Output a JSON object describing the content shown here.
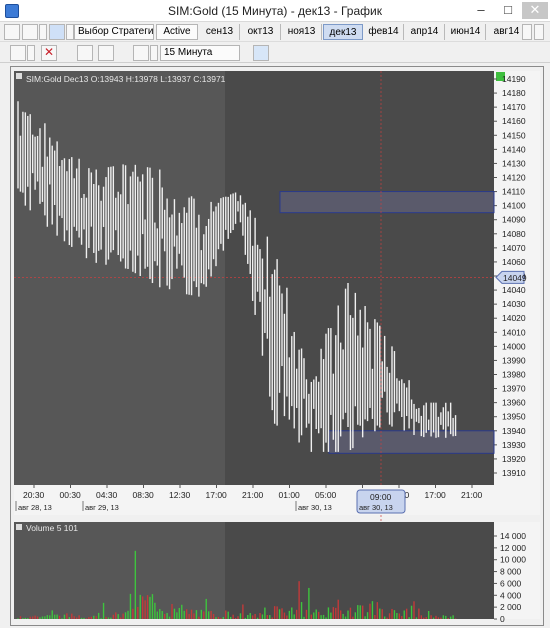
{
  "window": {
    "title": "SIM:Gold (15 Минута) - дек13 - График",
    "minimize": "–",
    "maximize": "□",
    "close": "✕"
  },
  "toolbar": {
    "strategy_label": "Выбор Стратегии",
    "active_label": "Active",
    "periods": [
      "сен13",
      "окт13",
      "ноя13",
      "дек13",
      "фев14",
      "апр14",
      "июн14",
      "авг14"
    ],
    "active_period": "дек13",
    "timeframe": "15 Минута"
  },
  "chart": {
    "header": "SIM:Gold Dec13 O:13943 H:13978 L:13937 C:13971",
    "price_ticks": [
      "14190",
      "14180",
      "14170",
      "14160",
      "14150",
      "14140",
      "14130",
      "14120",
      "14110",
      "14100",
      "14090",
      "14080",
      "14070",
      "14060",
      "14050",
      "14040",
      "14030",
      "14020",
      "14010",
      "14000",
      "13990",
      "13980",
      "13970",
      "13960",
      "13950",
      "13940",
      "13930",
      "13920",
      "13910"
    ],
    "current_price": "14049",
    "time_labels": [
      "20:30",
      "00:30",
      "04:30",
      "08:30",
      "12:30",
      "17:00",
      "21:00",
      "01:00",
      "05:00",
      "09:00",
      "13:00",
      "17:00",
      "21:00"
    ],
    "date_labels": [
      "авг 28, 13",
      "авг 29, 13",
      "авг 30, 13"
    ],
    "cursor_time": "09:00",
    "cursor_date": "авг 30, 13",
    "volume_header": "Volume 5 101",
    "volume_ticks": [
      "14 000",
      "12 000",
      "10 000",
      "8 000",
      "6 000",
      "4 000",
      "2 000",
      "0"
    ],
    "colors": {
      "background": "#4a4a4a",
      "session": "#575757",
      "bars": "#f0f0f0",
      "zone": "#2a3a8c",
      "cursor": "#c84040",
      "volume_up": "#3ec43e",
      "volume_down": "#c23a3a",
      "price_badge": "#c8d4ee"
    }
  },
  "chart_data": [
    {
      "type": "bar",
      "title": "SIM:Gold Dec13 O:13943 H:13978 L:13937 C:13971",
      "xlabel": "",
      "ylabel": "",
      "ylim": [
        13910,
        14190
      ],
      "x": [
        "20:30",
        "00:30",
        "04:30",
        "08:30",
        "12:30",
        "17:00",
        "21:00",
        "01:00",
        "05:00",
        "09:00",
        "13:00",
        "17:00"
      ],
      "high": [
        14182,
        14150,
        14125,
        14130,
        14125,
        14100,
        14110,
        14070,
        13985,
        14045,
        14010,
        13960
      ],
      "low": [
        14105,
        14080,
        14060,
        14055,
        14040,
        14035,
        14090,
        13945,
        13925,
        13925,
        13945,
        13935
      ],
      "zones": [
        {
          "from": 14095,
          "to": 14110
        },
        {
          "from": 13924,
          "to": 13940
        }
      ],
      "current": 14049,
      "cursor_time": "09:00"
    },
    {
      "type": "bar",
      "title": "Volume 5 101",
      "xlabel": "",
      "ylabel": "",
      "ylim": [
        0,
        14000
      ],
      "x": [
        "20:30",
        "00:30",
        "04:30",
        "08:30",
        "12:30",
        "17:00",
        "21:00",
        "01:00",
        "05:00",
        "09:00",
        "13:00",
        "17:00"
      ],
      "values": [
        1800,
        2200,
        2600,
        11500,
        4500,
        3500,
        2400,
        6500,
        4500,
        7500,
        4000,
        1500
      ]
    }
  ]
}
